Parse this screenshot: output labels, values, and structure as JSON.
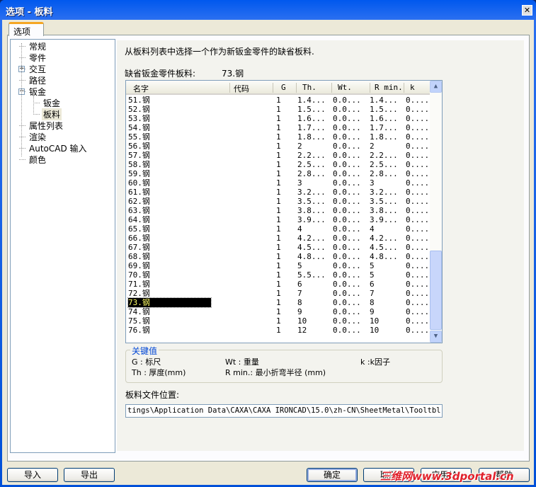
{
  "window": {
    "title": "选项 - 板料",
    "close": "✕"
  },
  "tab": "选项",
  "tree": [
    {
      "label": "常规",
      "level": 0
    },
    {
      "label": "零件",
      "level": 0
    },
    {
      "label": "交互",
      "level": 0,
      "expander": "+"
    },
    {
      "label": "路径",
      "level": 0
    },
    {
      "label": "钣金",
      "level": 0,
      "expander": "−"
    },
    {
      "label": "钣金",
      "level": 1
    },
    {
      "label": "板料",
      "level": 1,
      "selected": true
    },
    {
      "label": "属性列表",
      "level": 0
    },
    {
      "label": "渲染",
      "level": 0
    },
    {
      "label": "AutoCAD 输入",
      "level": 0
    },
    {
      "label": "颜色",
      "level": 0
    }
  ],
  "main": {
    "instruction": "从板料列表中选择一个作为新钣金零件的缺省板料.",
    "default_label": "缺省钣金零件板料:",
    "default_value": "73.钢",
    "columns": [
      "名字",
      "代码",
      "G",
      "Th.",
      "Wt.",
      "R min.",
      "k"
    ],
    "rows": [
      [
        "51.钢",
        "",
        "1",
        "1.4...",
        "0.0...",
        "1.4...",
        "0...."
      ],
      [
        "52.钢",
        "",
        "1",
        "1.5...",
        "0.0...",
        "1.5...",
        "0...."
      ],
      [
        "53.钢",
        "",
        "1",
        "1.6...",
        "0.0...",
        "1.6...",
        "0...."
      ],
      [
        "54.钢",
        "",
        "1",
        "1.7...",
        "0.0...",
        "1.7...",
        "0...."
      ],
      [
        "55.钢",
        "",
        "1",
        "1.8...",
        "0.0...",
        "1.8...",
        "0...."
      ],
      [
        "56.钢",
        "",
        "1",
        "2",
        "0.0...",
        "2",
        "0...."
      ],
      [
        "57.钢",
        "",
        "1",
        "2.2...",
        "0.0...",
        "2.2...",
        "0...."
      ],
      [
        "58.钢",
        "",
        "1",
        "2.5...",
        "0.0...",
        "2.5...",
        "0...."
      ],
      [
        "59.钢",
        "",
        "1",
        "2.8...",
        "0.0...",
        "2.8...",
        "0...."
      ],
      [
        "60.钢",
        "",
        "1",
        "3",
        "0.0...",
        "3",
        "0...."
      ],
      [
        "61.钢",
        "",
        "1",
        "3.2...",
        "0.0...",
        "3.2...",
        "0...."
      ],
      [
        "62.钢",
        "",
        "1",
        "3.5...",
        "0.0...",
        "3.5...",
        "0...."
      ],
      [
        "63.钢",
        "",
        "1",
        "3.8...",
        "0.0...",
        "3.8...",
        "0...."
      ],
      [
        "64.钢",
        "",
        "1",
        "3.9...",
        "0.0...",
        "3.9...",
        "0...."
      ],
      [
        "65.钢",
        "",
        "1",
        "4",
        "0.0...",
        "4",
        "0...."
      ],
      [
        "66.钢",
        "",
        "1",
        "4.2...",
        "0.0...",
        "4.2...",
        "0...."
      ],
      [
        "67.钢",
        "",
        "1",
        "4.5...",
        "0.0...",
        "4.5...",
        "0...."
      ],
      [
        "68.钢",
        "",
        "1",
        "4.8...",
        "0.0...",
        "4.8...",
        "0...."
      ],
      [
        "69.钢",
        "",
        "1",
        "5",
        "0.0...",
        "5",
        "0...."
      ],
      [
        "70.钢",
        "",
        "1",
        "5.5...",
        "0.0...",
        "5",
        "0...."
      ],
      [
        "71.钢",
        "",
        "1",
        "6",
        "0.0...",
        "6",
        "0...."
      ],
      [
        "72.钢",
        "",
        "1",
        "7",
        "0.0...",
        "7",
        "0...."
      ],
      [
        "73.钢",
        "",
        "1",
        "8",
        "0.0...",
        "8",
        "0...."
      ],
      [
        "74.钢",
        "",
        "1",
        "9",
        "0.0...",
        "9",
        "0...."
      ],
      [
        "75.钢",
        "",
        "1",
        "10",
        "0.0...",
        "10",
        "0...."
      ],
      [
        "76.钢",
        "",
        "1",
        "12",
        "0.0...",
        "10",
        "0...."
      ]
    ],
    "selected_row": "73.钢",
    "key": {
      "title": "关键值",
      "g": "G : 标尺",
      "wt": "Wt : 重量",
      "k": "k :k因子",
      "th": "Th : 厚度(mm)",
      "rmin": "R min.: 最小折弯半径 (mm)"
    },
    "file_label": "板料文件位置:",
    "file_path": "tings\\Application Data\\CAXA\\CAXA IRONCAD\\15.0\\zh-CN\\SheetMetal\\Tooltbl.txt"
  },
  "buttons": {
    "import": "导入",
    "export": "导出",
    "ok": "确定",
    "cancel": "取消",
    "apply": "应用(A)",
    "help": "帮助"
  },
  "watermark": "三维网www.3dportal.cn"
}
